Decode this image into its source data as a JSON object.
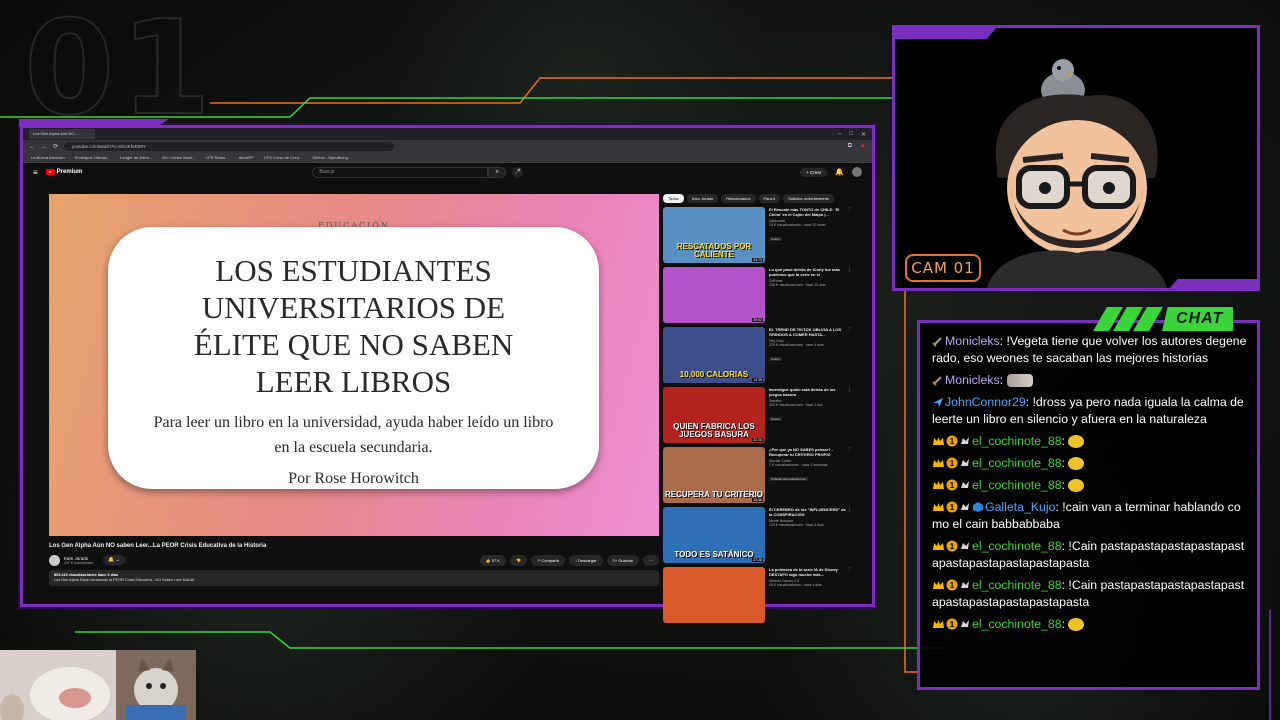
{
  "overlay": {
    "scene_number": "01",
    "cam_label": "CAM 01",
    "chat_title": "CHAT",
    "colors": {
      "frame": "#7b2fbf",
      "chat_accent": "#3bd43a",
      "cam_label": "#e8731f"
    }
  },
  "browser": {
    "tab_title": "Los Gen Alpha Aún NO...",
    "url": "youtube.com/watch?v=zEiUKfuEB9Y",
    "bookmarks": [
      "La Buena Atención",
      "Prototipos Ofertas...",
      "Ledger de Jdkm...",
      "IDC Centro Muni...",
      "CFD Retos...",
      "Athot/FF",
      "CFS Curso de Cren...",
      "GitHub - SpiroBeing..."
    ],
    "window_controls": [
      "–",
      "□",
      "✕"
    ]
  },
  "youtube": {
    "logo_text": "Premium",
    "search_placeholder": "Buscar",
    "create_label": "+ Crear",
    "notif_count": "9+",
    "video": {
      "tag": "EDUCACIÓN",
      "title": "LOS ESTUDIANTES UNIVERSITARIOS DE ÉLITE QUE NO SABEN LEER LIBROS",
      "subtitle": "Para leer un libro en la universidad, ayuda haber leído un libro en la escuela secundaria.",
      "author": "Por Rose Horowitch"
    },
    "video_title": "Los Gen Alpha Aún NO saben Leer...La PEOR Crisis Educativa de la Historia",
    "channel": {
      "name": "Kam Jurado",
      "subs": "437 K suscriptores",
      "subscribe_label": "🔔 ⌄"
    },
    "actions": {
      "likes": "👍 57 K",
      "dislike": "👎",
      "share": "↗ Compartir",
      "download": "↓ Descargar",
      "save": "≡+ Guardar",
      "more": "···"
    },
    "description": {
      "stats": "803.419 visualizaciones  hace 4 días",
      "text": "Los Gen Alpha Están Arrasando la PEOR Crisis Educativa...NO Saben Leer NADA!"
    },
    "chips": [
      "Todos",
      "Kam Jurado",
      "Relacionados",
      "Para ti",
      "Subidos recientemente"
    ],
    "recommended": [
      {
        "title": "El Rescate más TONTO de CHILE: 'El Chino' en el Cajón del Maipo |...",
        "channel": "Zaldorrald",
        "meta": "23 K visualizaciones · hace 22 horas",
        "badge": "Nuevo",
        "thumb_text": "RESCATADOS POR CALIENTE",
        "duration": "24:73",
        "thumb_bg": "#5a8fc4",
        "thumb_text_color": "#ffe03a"
      },
      {
        "title": "Lo que pasó detrás de iCarly fue más polémico que la serie en sí",
        "channel": "ZillPrime",
        "meta": "236 K visualizaciones · hace 10 días",
        "badge": "",
        "thumb_text": "",
        "duration": "29:02",
        "thumb_bg": "#b452c9",
        "thumb_text_color": "#ffffff"
      },
      {
        "title": "EL TREND DE TIKTOK OBLIGA A LOS GRINGOS A COMER HASTA...",
        "channel": "Hey Dray",
        "meta": "229 K visualizaciones · hace 4 días",
        "badge": "Nuevo",
        "thumb_text": "10,000 CALORIAS",
        "duration": "14:35",
        "thumb_bg": "#3c4f8c",
        "thumb_text_color": "#ffe03a"
      },
      {
        "title": "Investigué quién está detrás de los juegos basura",
        "channel": "Sebaiko",
        "meta": "303 K visualizaciones · hace 1 día",
        "badge": "Nuevo",
        "thumb_text": "QUIEN FABRICA LOS JUEGOS BASURA",
        "duration": "22:28",
        "thumb_bg": "#b3241f",
        "thumb_text_color": "#ffffff"
      },
      {
        "title": "¿Por qué ya NO SABES pensar? - Recuperar tu CRITERIO PROPIO",
        "channel": "Sinclair Carter",
        "meta": "7 K visualizaciones · hace 3 semanas",
        "badge": "Doblado automáticamente",
        "thumb_text": "RECUPERA TU CRITERIO",
        "duration": "19:46",
        "thumb_bg": "#a96b4a",
        "thumb_text_color": "#ffffff"
      },
      {
        "title": "El CEREBRO de los \"INFLUENCERS\" de la CONSPIRACIÓN",
        "channel": "Mente Humana",
        "meta": "129 K visualizaciones · hace 6 días",
        "badge": "",
        "thumb_text": "TODO ES SATÁNICO",
        "duration": "27:28",
        "thumb_bg": "#2f6fb6",
        "thumb_text_color": "#ffffff"
      },
      {
        "title": "La polémica de la serie IA de Disney DESTAPO algo mucho más...",
        "channel": "Detectó Oscuro 2.0",
        "meta": "49 K visualizaciones · hace 4 días",
        "badge": "",
        "thumb_text": "",
        "duration": "",
        "thumb_bg": "#d85a2a",
        "thumb_text_color": "#ffffff"
      }
    ]
  },
  "chat": {
    "messages": [
      {
        "badges": "sword",
        "user": "Monicleks",
        "user_color": "#b9a7f2",
        "text": ": !Vegeta tiene que volver los autores degenerado, eso weones te sacaban las mejores historias",
        "emote": ""
      },
      {
        "badges": "sword",
        "user": "Monicleks",
        "user_color": "#b9a7f2",
        "text": ": ",
        "emote": "cat-emote"
      },
      {
        "badges": "plane",
        "user": "JohnConnor29",
        "user_color": "#4aa7ff",
        "text": ": !dross ya pero nada iguala la calma de leerte un libro en silencio y afuera en la naturaleza",
        "emote": ""
      },
      {
        "badges": "crown-one-sub",
        "user": "el_cochinote_88",
        "user_color": "#3bd43a",
        "text": ": ",
        "emote": "pog-emote"
      },
      {
        "badges": "crown-one-sub",
        "user": "el_cochinote_88",
        "user_color": "#3bd43a",
        "text": ": ",
        "emote": "pog-emote"
      },
      {
        "badges": "crown-one-sub",
        "user": "el_cochinote_88",
        "user_color": "#3bd43a",
        "text": ": ",
        "emote": "pog-emote"
      },
      {
        "badges": "crown-one-cube",
        "user": "Galleta_Kujo",
        "user_color": "#4aa7ff",
        "text": ": !cain van a terminar hablando como el cain babbabbaba",
        "emote": ""
      },
      {
        "badges": "crown-one-sub",
        "user": "el_cochinote_88",
        "user_color": "#3bd43a",
        "text": ": !Cain pastapastapastapastapastapastapastapastapastapasta",
        "emote": ""
      },
      {
        "badges": "crown-one-sub",
        "user": "el_cochinote_88",
        "user_color": "#3bd43a",
        "text": ": !Cain pastapastapastapastapastapastapastapastapastapasta",
        "emote": ""
      },
      {
        "badges": "crown-one-sub",
        "user": "el_cochinote_88",
        "user_color": "#3bd43a",
        "text": ": ",
        "emote": "pog-emote"
      }
    ]
  }
}
